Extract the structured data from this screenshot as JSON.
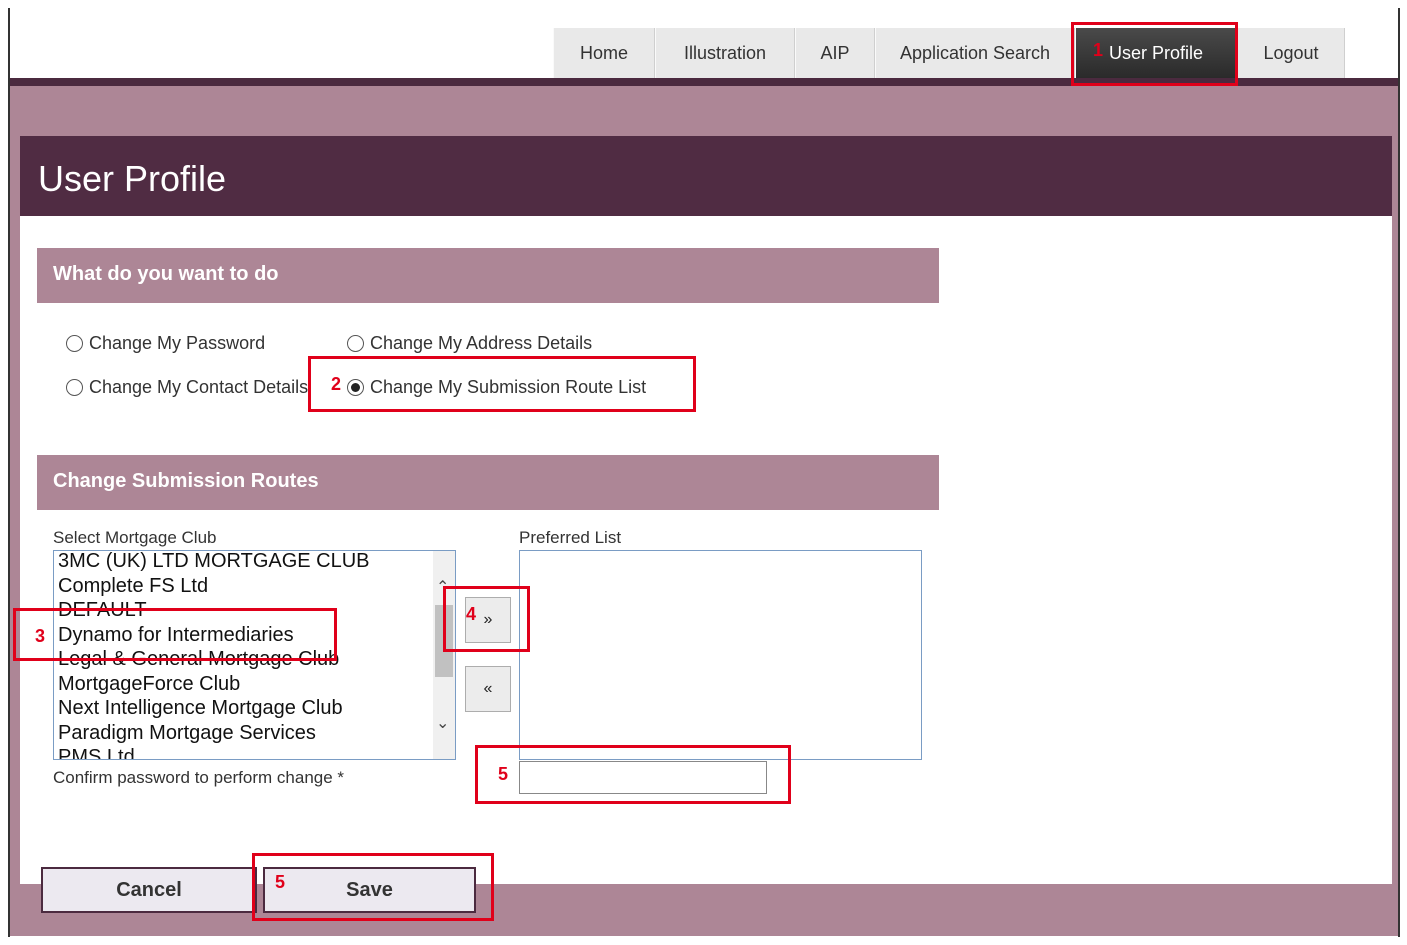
{
  "nav": {
    "tabs": [
      {
        "label": "Home"
      },
      {
        "label": "Illustration"
      },
      {
        "label": "AIP"
      },
      {
        "label": "Application Search"
      },
      {
        "label": "User Profile"
      },
      {
        "label": "Logout"
      }
    ],
    "active_tab": "User Profile"
  },
  "page_title": "User Profile",
  "what_section": {
    "header": "What do you want to do",
    "options": [
      {
        "label": "Change My Password",
        "selected": false
      },
      {
        "label": "Change My Address Details",
        "selected": false
      },
      {
        "label": "Change My Contact Details",
        "selected": false
      },
      {
        "label": "Change My Submission Route List",
        "selected": true
      }
    ]
  },
  "routes_section": {
    "header": "Change Submission Routes",
    "select_label": "Select Mortgage Club",
    "preferred_label": "Preferred List",
    "clubs": [
      "3MC (UK) LTD MORTGAGE CLUB",
      "Complete FS Ltd",
      "DEFAULT",
      "Dynamo for Intermediaries",
      "Legal & General Mortgage Club",
      "MortgageForce Club",
      "Next Intelligence Mortgage Club",
      "Paradigm Mortgage Services",
      "PMS Ltd"
    ],
    "preferred": [],
    "add_button": "»",
    "remove_button": "«",
    "confirm_label": "Confirm password to perform change *",
    "password_value": ""
  },
  "buttons": {
    "cancel": "Cancel",
    "save": "Save"
  },
  "annotations": [
    "1",
    "2",
    "3",
    "4",
    "5",
    "5"
  ],
  "colors": {
    "accent_dark": "#502c43",
    "accent_mauve": "#ad8696",
    "annotation_red": "#e0001a"
  }
}
